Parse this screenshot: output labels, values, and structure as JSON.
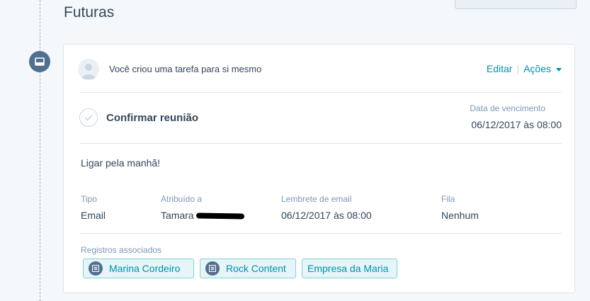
{
  "section": {
    "title": "Futuras"
  },
  "task": {
    "header_prefix": "Você criou uma tarefa para",
    "header_target": "si mesmo",
    "edit_label": "Editar",
    "actions_label": "Ações",
    "title": "Confirmar reunião",
    "due_label": "Data de vencimento",
    "due_value": "06/12/2017 às 08:00",
    "notes": "Ligar pela manhã!",
    "fields": {
      "type_label": "Tipo",
      "type_value": "Email",
      "assigned_label": "Atribuído a",
      "assigned_value": "Tamara",
      "reminder_label": "Lembrete de email",
      "reminder_value": "06/12/2017 às 08:00",
      "queue_label": "Fila",
      "queue_value": "Nenhum"
    },
    "associations_label": "Registros associados",
    "associations": [
      "Marina Cordeiro",
      "Rock Content",
      "Empresa da Maria"
    ]
  },
  "icons": {
    "timeline": "task-tray-icon",
    "avatar": "user-silhouette-icon",
    "check": "checkmark-icon",
    "record": "record-list-icon"
  },
  "colors": {
    "accent": "#0091ae",
    "timeline_badge": "#516f90",
    "chip_bg": "#e5f5f8",
    "chip_border": "#7fd1de"
  }
}
